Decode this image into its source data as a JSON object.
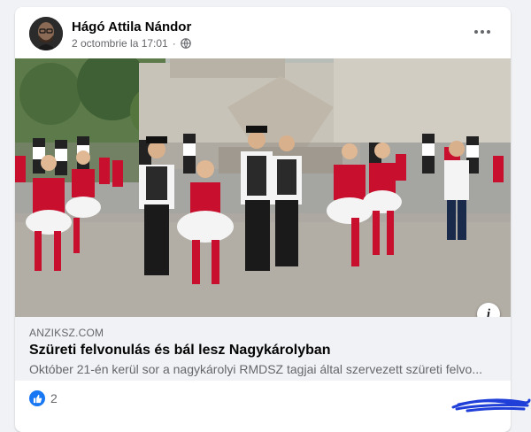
{
  "post": {
    "author_name": "Hágó Attila Nándor",
    "timestamp": "2 octombrie la 17:01",
    "separator": "·",
    "privacy_icon": "globe-icon",
    "more_icon": "more-options-icon"
  },
  "image": {
    "description_icon": "info-icon",
    "info_label": "i"
  },
  "link": {
    "domain": "ANZIKSZ.COM",
    "title": "Szüreti felvonulás és bál lesz Nagykárolyban",
    "description": "Október 21-én kerül sor a nagykárolyi RMDSZ tagjai által szervezett szüreti felvo..."
  },
  "reactions": {
    "icon": "like-icon",
    "count": "2"
  },
  "colors": {
    "brand_blue": "#1877f2",
    "background": "#f0f2f5",
    "secondary_text": "#65676b"
  }
}
